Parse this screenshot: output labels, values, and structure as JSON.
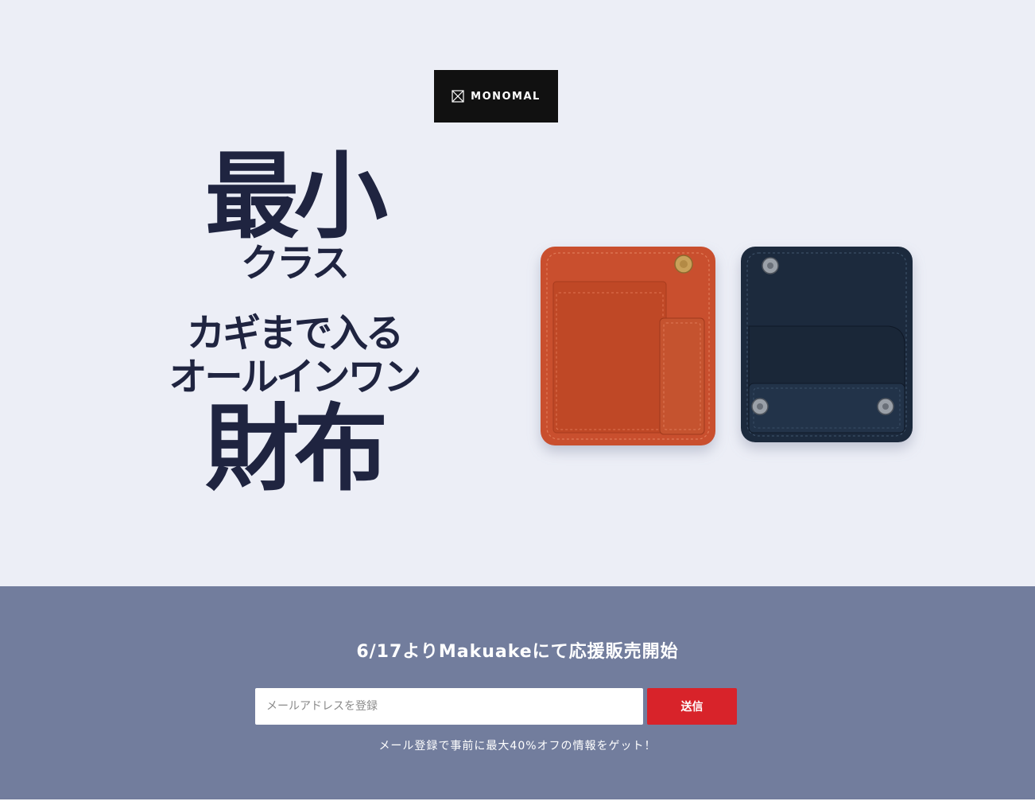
{
  "brand": {
    "logo_text": "MONOMAL",
    "logo_icon": "boxed-x-icon",
    "logo_bg": "#111111"
  },
  "hero": {
    "bg": "#eceef6",
    "headline_lines": [
      "最小",
      "クラス",
      "カギまで入る",
      "オールインワン",
      "財布"
    ],
    "text_color": "#1f2440",
    "product_image": "wallets-photo",
    "wallet_colors": [
      "#c9502d",
      "#1d2b3d"
    ]
  },
  "cta": {
    "bg": "#727d9d",
    "title": "6/17よりMakuakeにて応援販売開始",
    "email_placeholder": "メールアドレスを登録",
    "email_value": "",
    "submit_label": "送信",
    "submit_color": "#d8232a",
    "note": "メール登録で事前に最大40%オフの情報をゲット！"
  }
}
